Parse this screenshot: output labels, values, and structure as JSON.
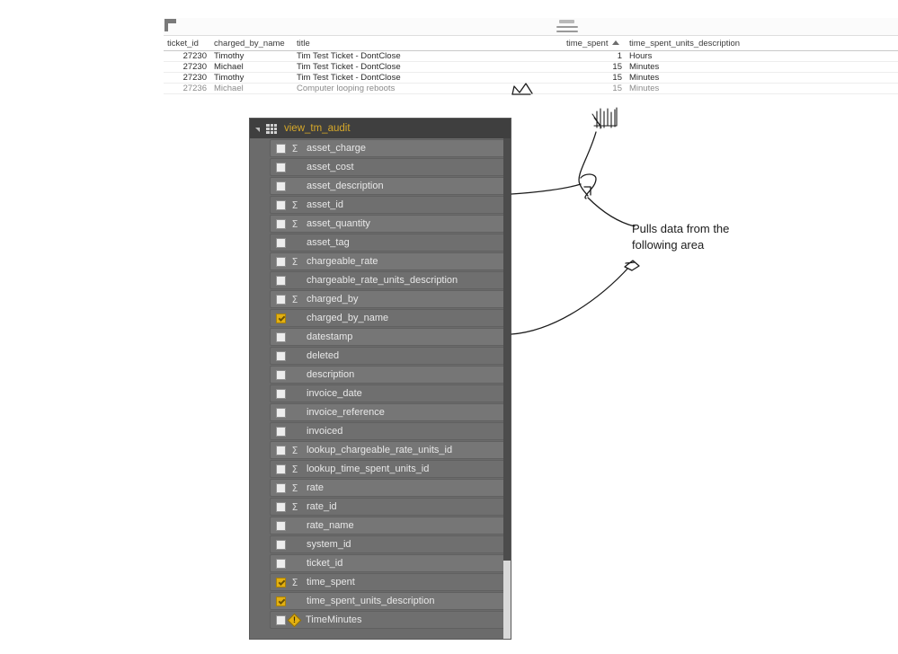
{
  "grid": {
    "columns": [
      {
        "key": "ticket_id",
        "label": "ticket_id",
        "align": "right"
      },
      {
        "key": "charged_by_name",
        "label": "charged_by_name",
        "align": "left"
      },
      {
        "key": "title",
        "label": "title",
        "align": "left"
      },
      {
        "key": "time_spent",
        "label": "time_spent",
        "align": "right",
        "sort": "ascending"
      },
      {
        "key": "time_spent_units_description",
        "label": "time_spent_units_description",
        "align": "left"
      }
    ],
    "rows": [
      {
        "ticket_id": "27230",
        "charged_by_name": "Timothy",
        "title": "Tim Test Ticket - DontClose",
        "time_spent": "1",
        "time_spent_units_description": "Hours"
      },
      {
        "ticket_id": "27230",
        "charged_by_name": "Michael",
        "title": "Tim Test Ticket - DontClose",
        "time_spent": "15",
        "time_spent_units_description": "Minutes"
      },
      {
        "ticket_id": "27230",
        "charged_by_name": "Timothy",
        "title": "Tim Test Ticket - DontClose",
        "time_spent": "15",
        "time_spent_units_description": "Minutes"
      },
      {
        "ticket_id": "27236",
        "charged_by_name": "Michael",
        "title": "Computer looping reboots",
        "time_spent": "15",
        "time_spent_units_description": "Minutes"
      }
    ],
    "icons": {
      "corner_marker": "select-all-corner-icon",
      "menu": "hamburger-menu-icon",
      "sort": "sort-ascending-icon"
    }
  },
  "field_list": {
    "header": {
      "title": "view_tm_audit",
      "expand_icon": "collapse-caret-icon",
      "table_icon": "table-icon",
      "title_color": "#d6a82a"
    },
    "fields": [
      {
        "label": "asset_charge",
        "checked": false,
        "aggregate": true
      },
      {
        "label": "asset_cost",
        "checked": false,
        "aggregate": false
      },
      {
        "label": "asset_description",
        "checked": false,
        "aggregate": false
      },
      {
        "label": "asset_id",
        "checked": false,
        "aggregate": true
      },
      {
        "label": "asset_quantity",
        "checked": false,
        "aggregate": true
      },
      {
        "label": "asset_tag",
        "checked": false,
        "aggregate": false
      },
      {
        "label": "chargeable_rate",
        "checked": false,
        "aggregate": true
      },
      {
        "label": "chargeable_rate_units_description",
        "checked": false,
        "aggregate": false
      },
      {
        "label": "charged_by",
        "checked": false,
        "aggregate": true
      },
      {
        "label": "charged_by_name",
        "checked": true,
        "aggregate": false
      },
      {
        "label": "datestamp",
        "checked": false,
        "aggregate": false
      },
      {
        "label": "deleted",
        "checked": false,
        "aggregate": false
      },
      {
        "label": "description",
        "checked": false,
        "aggregate": false
      },
      {
        "label": "invoice_date",
        "checked": false,
        "aggregate": false
      },
      {
        "label": "invoice_reference",
        "checked": false,
        "aggregate": false
      },
      {
        "label": "invoiced",
        "checked": false,
        "aggregate": false
      },
      {
        "label": "lookup_chargeable_rate_units_id",
        "checked": false,
        "aggregate": true
      },
      {
        "label": "lookup_time_spent_units_id",
        "checked": false,
        "aggregate": true
      },
      {
        "label": "rate",
        "checked": false,
        "aggregate": true
      },
      {
        "label": "rate_id",
        "checked": false,
        "aggregate": true
      },
      {
        "label": "rate_name",
        "checked": false,
        "aggregate": false
      },
      {
        "label": "system_id",
        "checked": false,
        "aggregate": false
      },
      {
        "label": "ticket_id",
        "checked": false,
        "aggregate": false
      },
      {
        "label": "time_spent",
        "checked": true,
        "aggregate": true
      },
      {
        "label": "time_spent_units_description",
        "checked": true,
        "aggregate": false
      },
      {
        "label": "TimeMinutes",
        "checked": false,
        "aggregate": false,
        "warning": true
      }
    ],
    "colors": {
      "panel_background": "#6b6b6b",
      "header_background": "#3f3f3f",
      "row_background": "#767676",
      "checked_checkbox": "#e3b011",
      "label_text": "#e8e8e8"
    },
    "scrollbar": {
      "name": "vertical-scrollbar"
    }
  },
  "annotations": {
    "note": "Pulls data from the\nfollowing area",
    "note_line1": "Pulls data from the",
    "note_line2": "following area"
  }
}
